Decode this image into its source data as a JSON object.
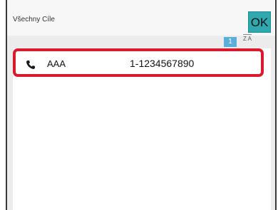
{
  "header": {
    "title": "Všechny Cíle",
    "ok_label": "OK"
  },
  "pager": {
    "current_page": "1"
  },
  "sort": {
    "icon": "sort-alpha-icon",
    "letters": "Z A"
  },
  "list": {
    "items": [
      {
        "name": "AAA",
        "number": "1-1234567890",
        "icon": "phone-icon"
      }
    ]
  },
  "colors": {
    "ok_button": "#2fa8b0",
    "selection_border": "#d8192e",
    "page_indicator": "#5aaed8"
  }
}
